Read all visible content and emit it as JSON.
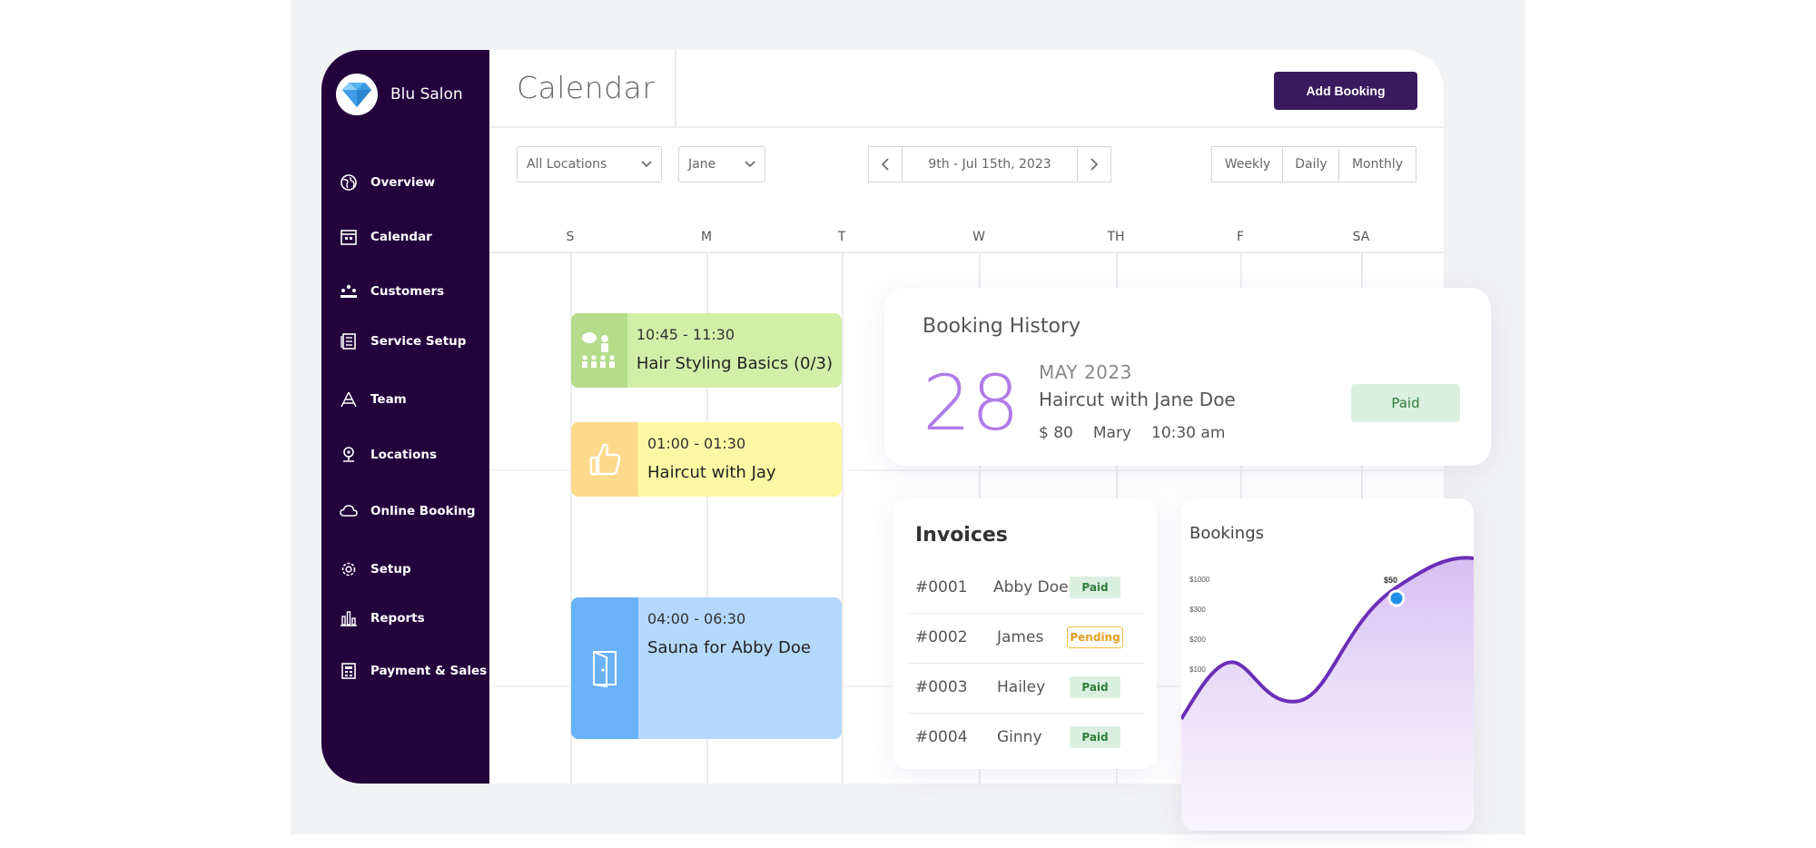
{
  "brand": {
    "name": "Blu Salon"
  },
  "sidebar": {
    "items": [
      {
        "label": "Overview",
        "icon": "globe-icon"
      },
      {
        "label": "Calendar",
        "icon": "calendar-icon"
      },
      {
        "label": "Customers",
        "icon": "customers-icon"
      },
      {
        "label": "Service Setup",
        "icon": "service-icon"
      },
      {
        "label": "Team",
        "icon": "team-icon"
      },
      {
        "label": "Locations",
        "icon": "location-icon"
      },
      {
        "label": "Online Booking",
        "icon": "cloud-icon"
      },
      {
        "label": "Setup",
        "icon": "gear-icon"
      },
      {
        "label": "Reports",
        "icon": "bar-chart-icon"
      },
      {
        "label": "Payment & Sales",
        "icon": "receipt-icon"
      }
    ]
  },
  "header": {
    "title": "Calendar",
    "add_booking": "Add Booking"
  },
  "filters": {
    "location": "All Locations",
    "staff": "Jane",
    "date_range": "9th - Jul 15th, 2023",
    "views": [
      "Weekly",
      "Daily",
      "Monthly"
    ]
  },
  "days": [
    "S",
    "M",
    "T",
    "W",
    "TH",
    "F",
    "SA"
  ],
  "events": [
    {
      "time": "10:45 - 11:30",
      "title": "Hair Styling Basics (0/3)",
      "color": "#d2efa8",
      "icon_color": "#b4dc8a"
    },
    {
      "time": "01:00 - 01:30",
      "title": "Haircut with Jay",
      "color": "#fcf8a4",
      "icon_color": "#fdd98c"
    },
    {
      "time": "04:00 - 06:30",
      "title": "Sauna for Abby Doe",
      "color": "#b4d8fb",
      "icon_color": "#69b2f7"
    }
  ],
  "booking_history": {
    "title": "Booking History",
    "day": "28",
    "month": "MAY 2023",
    "service": "Haircut with Jane Doe",
    "price": "$ 80",
    "staff": "Mary",
    "time": "10:30 am",
    "status": "Paid"
  },
  "invoices": {
    "title": "Invoices",
    "rows": [
      {
        "id": "#0001",
        "name": "Abby Doe",
        "status": "Paid"
      },
      {
        "id": "#0002",
        "name": "James",
        "status": "Pending"
      },
      {
        "id": "#0003",
        "name": "Hailey",
        "status": "Paid"
      },
      {
        "id": "#0004",
        "name": "Ginny",
        "status": "Paid"
      }
    ]
  },
  "bookings_chart": {
    "title": "Bookings",
    "y_labels": [
      "$1000",
      "$300",
      "$200",
      "$100"
    ],
    "highlight_label": "$50",
    "accent": "#6a2fb8",
    "point_color": "#1e90e8"
  }
}
